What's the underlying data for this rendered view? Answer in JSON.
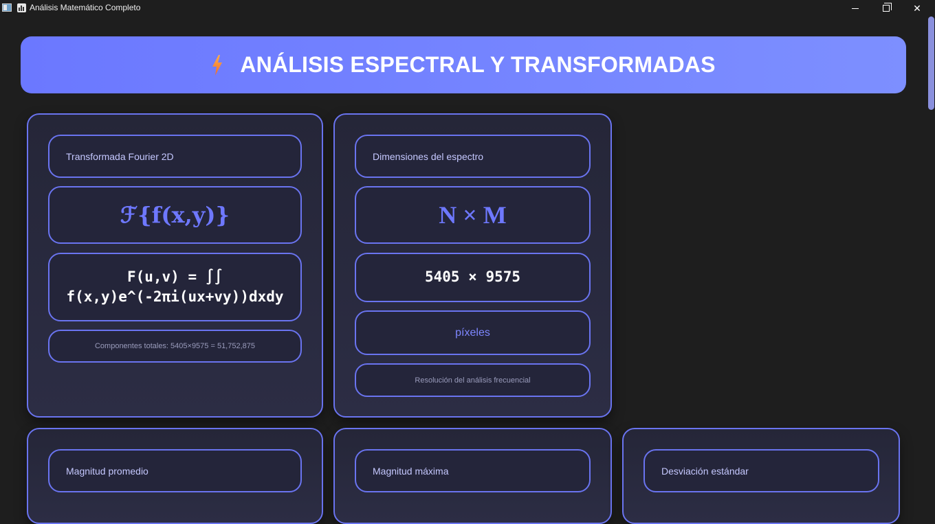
{
  "window": {
    "title": "Análisis Matemático Completo"
  },
  "banner": {
    "icon": "lightning-bolt-icon",
    "title": "ANÁLISIS ESPECTRAL Y TRANSFORMADAS",
    "gradient": [
      "#6b78ff",
      "#7d8fff"
    ]
  },
  "cards": {
    "fourier": {
      "label": "Transformada Fourier 2D",
      "symbol": "ℱ{f(x,y)}",
      "formula_line1": "F(u,v) = ∫∫",
      "formula_line2": "f(x,y)e^(-2πi(ux+vy))dxdy",
      "note": "Componentes totales: 5405×9575 = 51,752,875"
    },
    "dimensions": {
      "label": "Dimensiones del espectro",
      "symbol": "N × M",
      "value": "5405 × 9575",
      "unit": "píxeles",
      "note": "Resolución del análisis frecuencial"
    },
    "magnitude_avg": {
      "label": "Magnitud promedio"
    },
    "magnitude_max": {
      "label": "Magnitud máxima"
    },
    "std_dev": {
      "label": "Desviación estándar"
    }
  },
  "colors": {
    "accent": "#6a74f0",
    "accent_text": "#6e78ff",
    "background": "#1e1e1e"
  }
}
